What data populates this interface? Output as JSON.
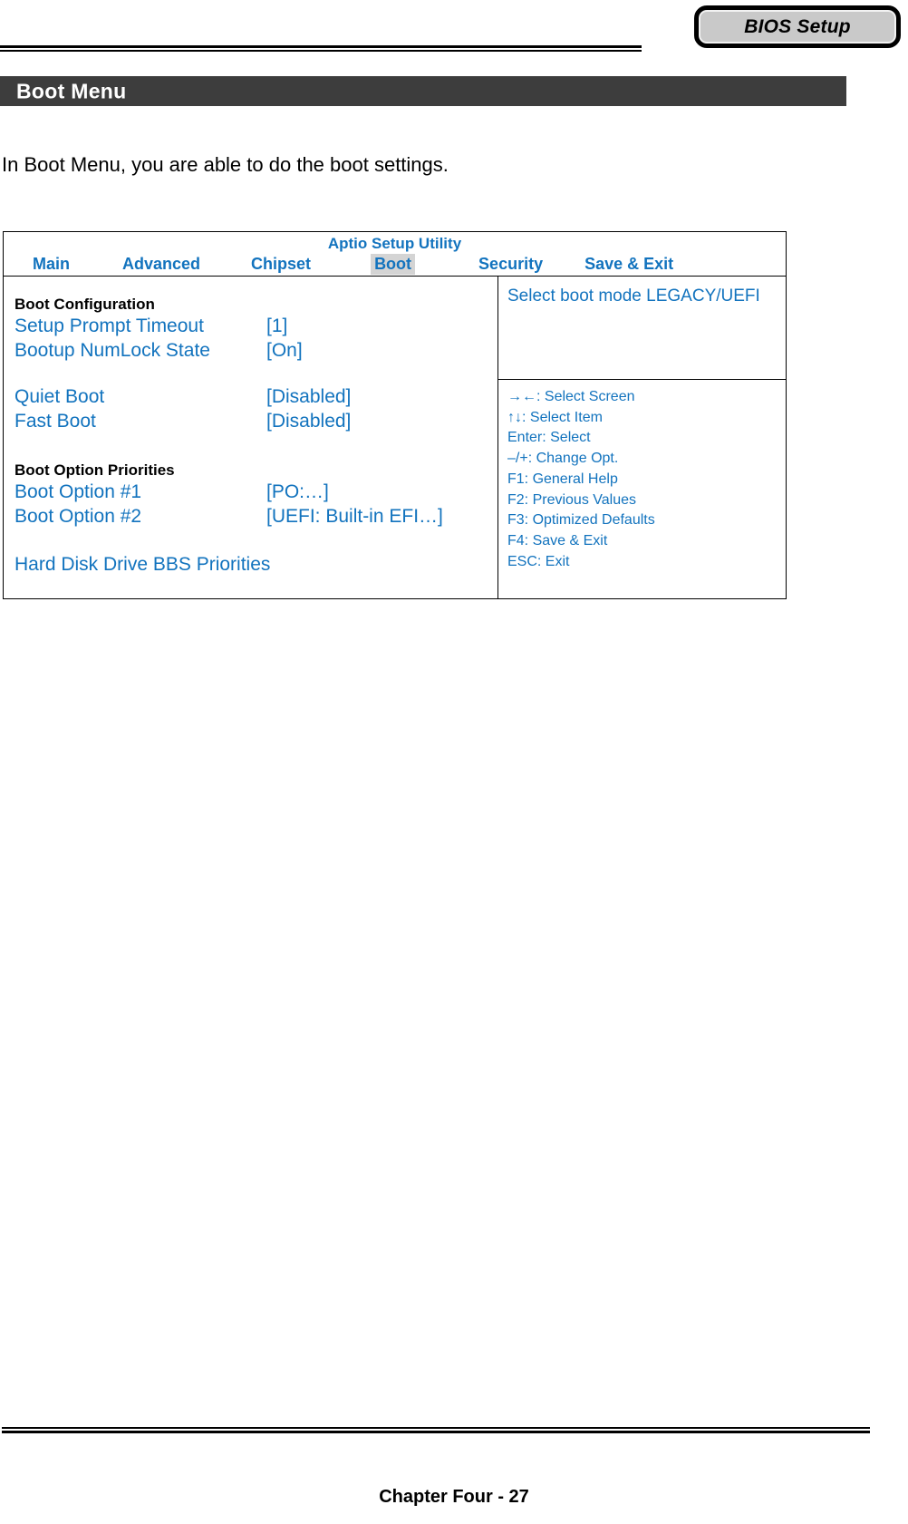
{
  "header": {
    "corner_tab_label": "BIOS Setup"
  },
  "section": {
    "banner_title": "Boot Menu"
  },
  "intro": {
    "paragraph": "In Boot Menu, you are able to do the boot settings."
  },
  "bios": {
    "utility_title": "Aptio Setup Utility",
    "tabs": [
      {
        "label": "Main",
        "active": false
      },
      {
        "label": "Advanced",
        "active": false
      },
      {
        "label": "Chipset",
        "active": false
      },
      {
        "label": "Boot",
        "active": true
      },
      {
        "label": "Security",
        "active": false
      },
      {
        "label": "Save & Exit",
        "active": false
      }
    ],
    "groups": [
      {
        "heading": "Boot Configuration",
        "items": [
          {
            "label": "Setup Prompt Timeout",
            "value": "[1]"
          },
          {
            "label": "Bootup NumLock State",
            "value": "[On]"
          }
        ]
      },
      {
        "items": [
          {
            "label": "Quiet Boot",
            "value": "[Disabled]"
          },
          {
            "label": "Fast Boot",
            "value": "[Disabled]"
          }
        ]
      },
      {
        "heading": "Boot Option Priorities",
        "items": [
          {
            "label": "Boot Option #1",
            "value": "[PO:…]"
          },
          {
            "label": "Boot Option #2",
            "value": "[UEFI: Built-in EFI…]"
          }
        ]
      }
    ],
    "submenu_link": "Hard Disk Drive BBS Priorities",
    "help_text": "Select boot mode LEGACY/UEFI",
    "key_legend": [
      "→←: Select Screen",
      "↑↓: Select Item",
      "Enter: Select",
      "–/+: Change Opt.",
      "F1: General Help",
      "F2: Previous Values",
      "F3: Optimized Defaults",
      "F4: Save & Exit",
      "ESC: Exit"
    ]
  },
  "footer": {
    "page_label": "Chapter Four - 27"
  },
  "colors": {
    "bios_blue": "#1273be",
    "banner_gray": "#3d3d3d",
    "tab_highlight": "#d4d4d4",
    "corner_tab_fill": "#c9c9c9"
  }
}
